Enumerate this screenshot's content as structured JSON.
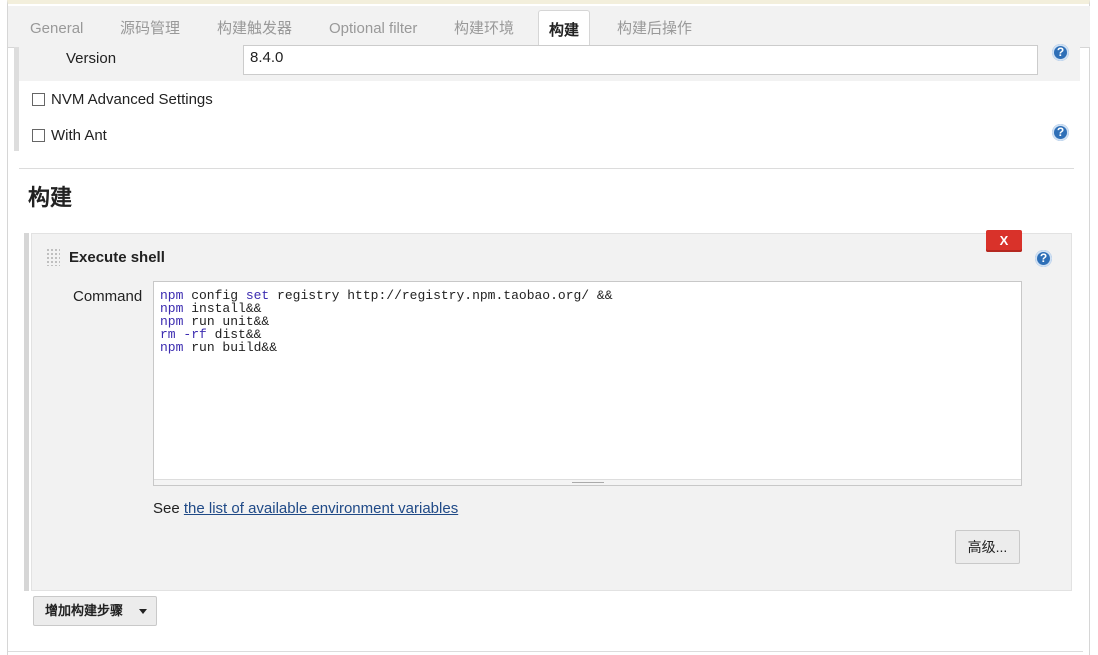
{
  "tabs": [
    {
      "label": "General",
      "active": false
    },
    {
      "label": "源码管理",
      "active": false
    },
    {
      "label": "构建触发器",
      "active": false
    },
    {
      "label": "Optional filter",
      "active": false
    },
    {
      "label": "构建环境",
      "active": false
    },
    {
      "label": "构建",
      "active": true
    },
    {
      "label": "构建后操作",
      "active": false
    }
  ],
  "nvm": {
    "version_label": "Version",
    "version_value": "8.4.0",
    "advanced_settings_label": "NVM Advanced Settings",
    "with_ant_label": "With Ant"
  },
  "build": {
    "section_title": "构建",
    "step": {
      "title": "Execute shell",
      "delete_label": "X",
      "command_label": "Command",
      "command_lines": [
        "npm config set registry http://registry.npm.taobao.org/ &&",
        "npm install&&",
        "npm run unit&&",
        "rm -rf dist&&",
        "npm run build&&"
      ],
      "see_prefix": "See",
      "env_link": "the list of available environment variables",
      "advanced_label": "高级..."
    },
    "add_step_label": "增加构建步骤"
  },
  "icons": {
    "help": "help-icon",
    "drag": "drag-handle-icon",
    "dropdown": "caret-down-icon"
  },
  "colors": {
    "link": "#204a87",
    "delete": "#d9322a",
    "help": "#2e6fb7",
    "keyword": "#3b2bb0"
  }
}
